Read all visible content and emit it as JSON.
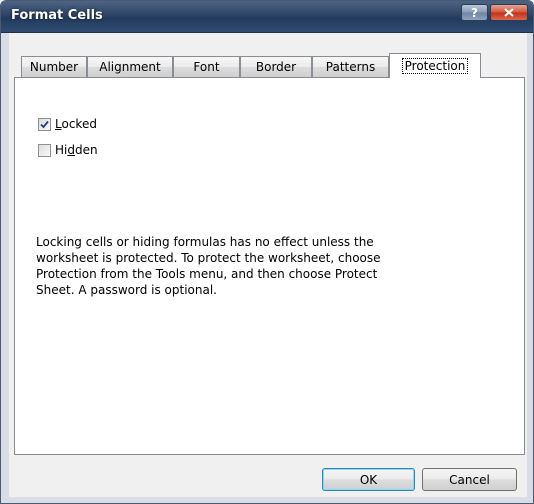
{
  "window": {
    "title": "Format Cells",
    "help_label": "?",
    "close_icon": "close-x-icon"
  },
  "tabs": [
    {
      "label": "Number",
      "active": false
    },
    {
      "label": "Alignment",
      "active": false
    },
    {
      "label": "Font",
      "active": false
    },
    {
      "label": "Border",
      "active": false
    },
    {
      "label": "Patterns",
      "active": false
    },
    {
      "label": "Protection",
      "active": true
    }
  ],
  "protection": {
    "locked": {
      "label_pre": "",
      "label_key": "L",
      "label_post": "ocked",
      "checked": true
    },
    "hidden": {
      "label_pre": "Hi",
      "label_key": "d",
      "label_post": "den",
      "checked": false
    },
    "info_text": "Locking cells or hiding formulas has no effect unless the worksheet is protected. To protect the worksheet, choose Protection from the Tools menu, and then choose Protect Sheet. A password is optional."
  },
  "buttons": {
    "ok": "OK",
    "cancel": "Cancel"
  },
  "colors": {
    "titlebar": "#2e4566",
    "close_button": "#c0321a",
    "dialog_face": "#f0f0f0",
    "default_button_border": "#3c7fb1"
  }
}
